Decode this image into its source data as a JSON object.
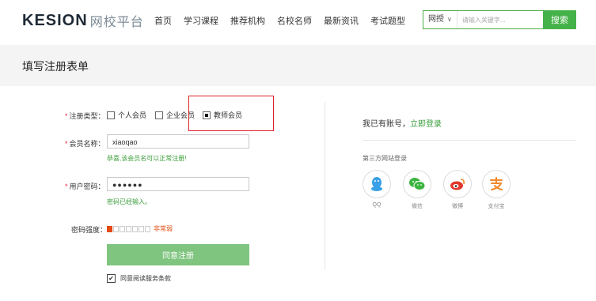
{
  "brand": {
    "logo_main": "KESION",
    "logo_sub": "网校平台"
  },
  "nav": [
    "首页",
    "学习课程",
    "推荐机构",
    "名校名师",
    "最新资讯",
    "考试题型"
  ],
  "search": {
    "category": "网授",
    "placeholder": "请输入关键字...",
    "button": "搜索"
  },
  "page_title": "填写注册表单",
  "form": {
    "type_label": "注册类型：",
    "types": [
      {
        "label": "个人会员",
        "checked": false
      },
      {
        "label": "企业会员",
        "checked": false
      },
      {
        "label": "教师会员",
        "checked": true
      }
    ],
    "username_label": "会员名称：",
    "username_value": "xiaoqao",
    "username_hint": "恭喜,该会员名可以正常注册!",
    "password_label": "用户密码：",
    "password_value": "●●●●●●",
    "password_hint": "密码已经输入。",
    "strength_label": "密码强度：",
    "strength_text": "非常弱",
    "submit": "同意注册",
    "agree": "同意阅读服务条款"
  },
  "right": {
    "have_account": "我已有账号，",
    "login_link": "立即登录",
    "third_party_title": "第三方网站登录",
    "providers": [
      {
        "label": "QQ",
        "icon": "qq-icon",
        "color": "#3aa0e8"
      },
      {
        "label": "微信",
        "icon": "wechat-icon",
        "color": "#3bb43f"
      },
      {
        "label": "微博",
        "icon": "weibo-icon",
        "color": "#e0392b"
      },
      {
        "label": "支付宝",
        "icon": "alipay-icon",
        "color": "#f08a2c"
      }
    ]
  },
  "colors": {
    "accent": "#45b249",
    "highlight_box": "#d9242b"
  }
}
